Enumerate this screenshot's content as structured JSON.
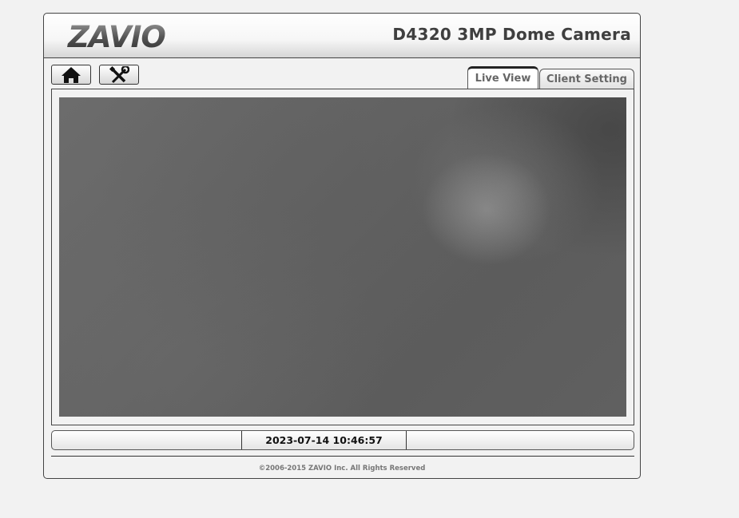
{
  "header": {
    "logo_text": "ZAVIO",
    "title": "D4320 3MP Dome Camera"
  },
  "toolbar": {
    "home_icon": "home-icon",
    "settings_icon": "tools-icon"
  },
  "tabs": [
    {
      "label": "Live View",
      "active": true
    },
    {
      "label": "Client Setting",
      "active": false
    }
  ],
  "status_bar": {
    "left": "",
    "datetime": "2023-07-14 10:46:57",
    "right": ""
  },
  "footer": {
    "copyright": "©2006-2015 ZAVIO Inc. All Rights Reserved"
  },
  "colors": {
    "page_bg": "#f2f2f2",
    "title_text": "#3f3f3f",
    "border": "#444444"
  }
}
